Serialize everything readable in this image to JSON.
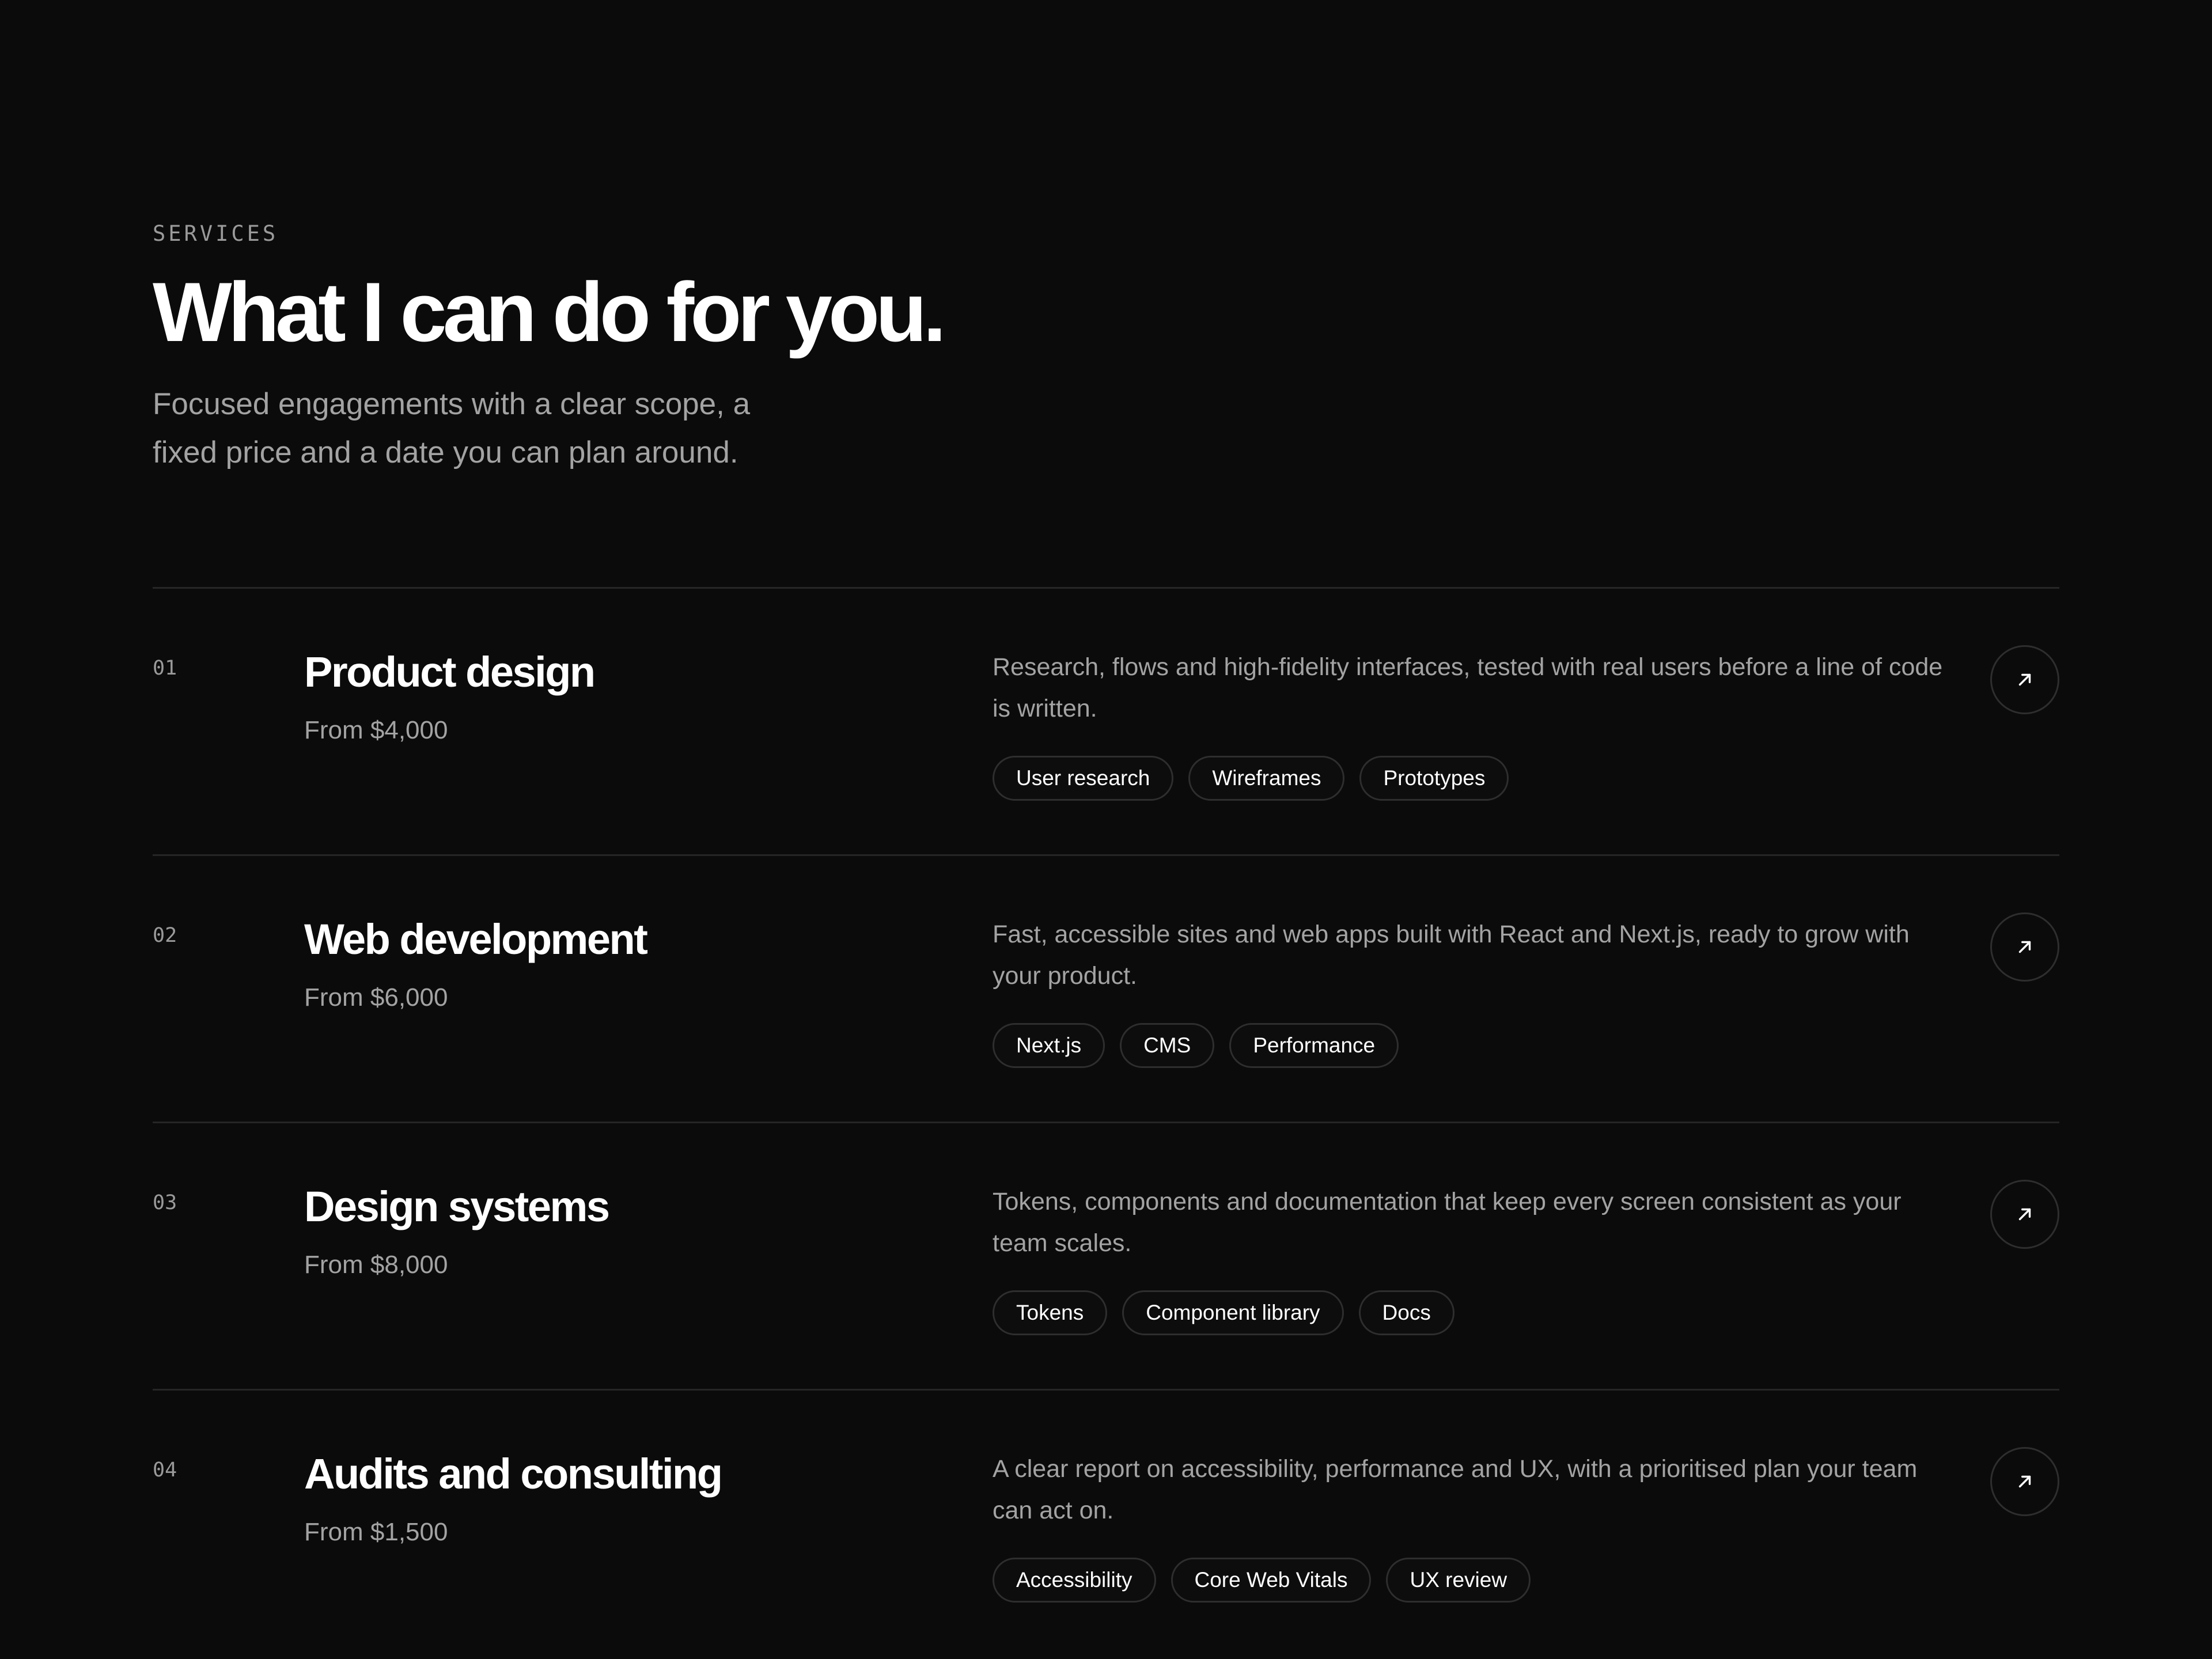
{
  "header": {
    "eyebrow": "SERVICES",
    "title": "What I can do for you.",
    "subtitle": "Focused engagements with a clear scope, a fixed price and a date you can plan around."
  },
  "services": [
    {
      "number": "01",
      "title": "Product design",
      "price": "From $4,000",
      "description": "Research, flows and high-fidelity interfaces, tested with real users before a line of code is written.",
      "tags": [
        "User research",
        "Wireframes",
        "Prototypes"
      ],
      "icon": "arrow-up-right-icon"
    },
    {
      "number": "02",
      "title": "Web development",
      "price": "From $6,000",
      "description": "Fast, accessible sites and web apps built with React and Next.js, ready to grow with your product.",
      "tags": [
        "Next.js",
        "CMS",
        "Performance"
      ],
      "icon": "arrow-up-right-icon"
    },
    {
      "number": "03",
      "title": "Design systems",
      "price": "From $8,000",
      "description": "Tokens, components and documentation that keep every screen consistent as your team scales.",
      "tags": [
        "Tokens",
        "Component library",
        "Docs"
      ],
      "icon": "arrow-up-right-icon"
    },
    {
      "number": "04",
      "title": "Audits and consulting",
      "price": "From $1,500",
      "description": "A clear report on accessibility, performance and UX, with a prioritised plan your team can act on.",
      "tags": [
        "Accessibility",
        "Core Web Vitals",
        "UX review"
      ],
      "icon": "arrow-up-right-icon"
    }
  ],
  "colors": {
    "background": "#0b0b0b",
    "text": "#ffffff",
    "muted": "#a3a3a3",
    "border": "#262626"
  }
}
